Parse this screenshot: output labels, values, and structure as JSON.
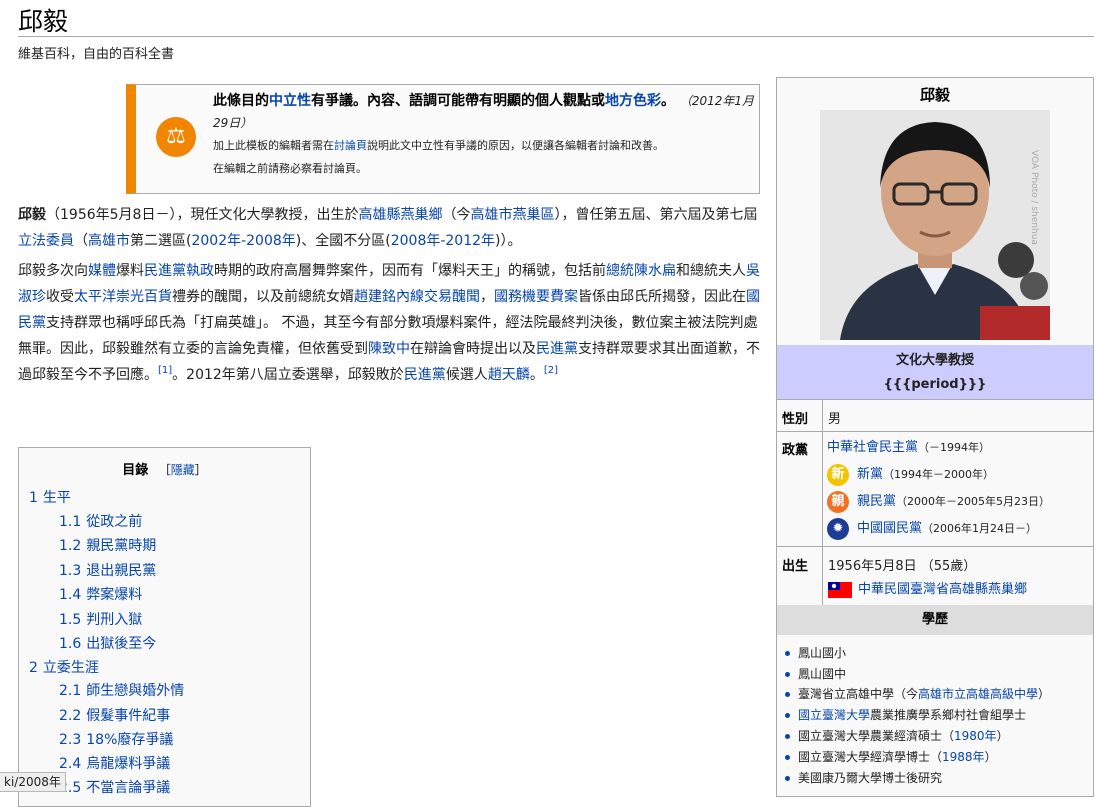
{
  "page": {
    "title": "邱毅",
    "subtitle": "維基百科，自由的百科全書"
  },
  "ambox": {
    "icon": "scales-icon",
    "accent_color": "#f28500",
    "heading_1": "此條目的",
    "heading_link_1": "中立性",
    "heading_2": "有爭議。內容、語調可能帶有明顯的個人觀點或",
    "heading_link_2": "地方色彩",
    "heading_3": "。",
    "date": "（2012年1月29日）",
    "line2_a": "加上此模板的編輯者需在",
    "line2_link": "討論頁",
    "line2_b": "說明此文中立性有爭議的原因，以便讓各編輯者討論和改善。",
    "line3": "在編輯之前請務必察看討論頁。"
  },
  "intro": {
    "bold_name": "邱毅",
    "t1": "（1956年5月8日－），現任文化大學教授，出生於",
    "l1": "高雄縣燕巢鄉",
    "t2": "（今",
    "l2": "高雄市燕巢區",
    "t3": "），曾任第五屆、第六屆及第七屆",
    "l3": "立法委員",
    "t4": "（",
    "l4": "高雄市",
    "t5": "第二選區(",
    "l5": "2002年-2008年",
    "t6": ")、全國不分區(",
    "l6": "2008年-2012年",
    "t7": ")）。"
  },
  "para2": {
    "t1": "邱毅多次向",
    "l1": "媒體",
    "t2": "爆料",
    "l2": "民進黨",
    "l3": "執政",
    "t3": "時期的政府高層舞弊案件，因而有「爆料天王」的稱號，包括前",
    "l4": "總統",
    "l5": "陳水扁",
    "t4": "和總統夫人",
    "l6": "吳淑珍",
    "t5": "收受",
    "l7": "太平洋崇光百貨",
    "t6": "禮券的醜聞，以及前總統女婿",
    "l8": "趙建銘",
    "l9": "內線交易醜聞",
    "t7": "，",
    "l10": "國務機要費案",
    "t8": "皆係由邱氏所揭發，因此在",
    "l11": "國民黨",
    "t9": "支持群眾也稱呼邱氏為「打扁英雄」。 不過，其至今有部分數項爆料案件，經法院最終判決後，數位案主被法院判處無罪。因此，邱毅雖然有立委的言論免責權，但依舊受到",
    "l12": "陳致中",
    "t10": "在辯論會時提出以及",
    "l13": "民進黨",
    "t11": "支持群眾要求其出面道歉，不過邱毅至今不予回應。",
    "ref1": "[1]",
    "t12": "。2012年第八屆立委選舉，邱毅敗於",
    "l14": "民進黨",
    "t13": "候選人",
    "l15": "趙天麟",
    "t14": "。",
    "ref2": "[2]"
  },
  "toc": {
    "title": "目錄",
    "toggle_open": "［",
    "toggle": "隱藏",
    "toggle_close": "］",
    "items": [
      {
        "num": "1",
        "label": "生平"
      },
      {
        "num": "1.1",
        "label": "從政之前"
      },
      {
        "num": "1.2",
        "label": "親民黨時期"
      },
      {
        "num": "1.3",
        "label": "退出親民黨"
      },
      {
        "num": "1.4",
        "label": "弊案爆料"
      },
      {
        "num": "1.5",
        "label": "判刑入獄"
      },
      {
        "num": "1.6",
        "label": "出獄後至今"
      },
      {
        "num": "2",
        "label": "立委生涯"
      },
      {
        "num": "2.1",
        "label": "師生戀與婚外情"
      },
      {
        "num": "2.2",
        "label": "假髮事件紀事"
      },
      {
        "num": "2.3",
        "label": "18%廢存爭議"
      },
      {
        "num": "2.4",
        "label": "烏龍爆料爭議"
      },
      {
        "num": "2.5",
        "label": "不當言論爭議"
      }
    ]
  },
  "infobox": {
    "caption": "邱毅",
    "photo_watermark": "VOA Photo / shenhua",
    "band_line1": "文化大學教授",
    "band_line2": "{{{period}}}",
    "gender_label": "性別",
    "gender_value": "男",
    "party_label": "政黨",
    "parties": [
      {
        "name": "中華社會民主黨",
        "period": "（－1994年）",
        "icon": "none",
        "icon_color": ""
      },
      {
        "name": "新黨",
        "period": "（1994年－2000年）",
        "icon": "new-party-logo-icon",
        "icon_color": "#f3c300",
        "glyph": "新"
      },
      {
        "name": "親民黨",
        "period": "（2000年－2005年5月23日）",
        "icon": "pfp-logo-icon",
        "icon_color": "#f36f21",
        "glyph": "親"
      },
      {
        "name": "中國國民黨",
        "period": "（2006年1月24日－）",
        "icon": "kmt-sun-icon",
        "icon_color": "#1e3c96",
        "glyph": "✹"
      }
    ],
    "born_label": "出生",
    "born_date": "1956年5月8日 （55歲）",
    "born_place": "中華民國臺灣省高雄縣燕巢鄉",
    "education_header": "學歷",
    "education": [
      {
        "text": "鳳山國小",
        "link": ""
      },
      {
        "text": "鳳山國中",
        "link": ""
      },
      {
        "text": "臺灣省立高雄中學（今",
        "link": "高雄市立高雄高級中學",
        "tail": "）"
      },
      {
        "text": "",
        "link": "國立臺灣大學",
        "tail": "農業推廣學系鄉村社會組學士"
      },
      {
        "text": "國立臺灣大學農業經濟碩士（",
        "link": "1980年",
        "tail": "）"
      },
      {
        "text": "國立臺灣大學經濟學博士（",
        "link": "1988年",
        "tail": "）"
      },
      {
        "text": "美國康乃爾大學博士後研究",
        "link": ""
      }
    ]
  },
  "statusbar": {
    "text": "ki/2008年"
  }
}
